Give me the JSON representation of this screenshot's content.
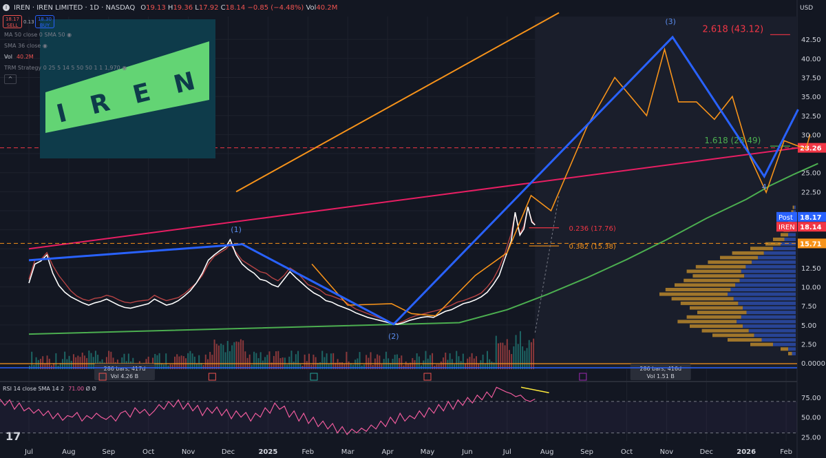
{
  "header": {
    "symbol": "IREN · IREN LIMITED · 1D · NASDAQ",
    "open_label": "O",
    "open": "19.13",
    "high_label": "H",
    "high": "19.36",
    "low_label": "L",
    "low": "17.92",
    "close_label": "C",
    "close": "18.14",
    "change": "−0.85 (−4.48%)",
    "vol_label": "Vol",
    "vol": "40.2M"
  },
  "trade": {
    "sell_price": "18.17",
    "sell_label": "SELL",
    "spread": "0.13",
    "buy_price": "18.30",
    "buy_label": "BUY"
  },
  "indicators": [
    {
      "label": "MA 50 close 0 SMA 50",
      "value": ""
    },
    {
      "label": "SMA 36 close",
      "value": ""
    },
    {
      "label": "Vol",
      "value": "40.2M"
    },
    {
      "label": "TRM Strategy 0 25 5 14 5 50 50 1 1 1,970",
      "value": ""
    }
  ],
  "logo_text": "I R E N",
  "colors": {
    "background": "#131722",
    "up": "#26a69a",
    "down": "#ef5350",
    "wave": "#2962ff",
    "projection": "#f7931a",
    "trend_pink": "#e91e63",
    "curve_green": "#4caf50",
    "rsi": "#ef5b9c",
    "fib_red": "#f23645",
    "fib_green": "#4caf50",
    "fib_orange": "#f7931a",
    "logo_bg": "#0e3b4a",
    "logo_fg": "#63d474"
  },
  "chart_data": {
    "type": "line",
    "title": "IREN · IREN LIMITED · 1D · NASDAQ",
    "currency": "USD",
    "x_labels": [
      "Jul",
      "Aug",
      "Sep",
      "Oct",
      "Nov",
      "Dec",
      "2025",
      "Feb",
      "Mar",
      "Apr",
      "May",
      "Jun",
      "Jul",
      "Aug",
      "Sep",
      "Oct",
      "Nov",
      "Dec",
      "2026",
      "Feb"
    ],
    "x_index": [
      0,
      1,
      2,
      3,
      4,
      5,
      6,
      7,
      8,
      9,
      10,
      11,
      12,
      13,
      14,
      15,
      16,
      17,
      18,
      19
    ],
    "y_ticks": [
      0,
      2.5,
      5,
      7.5,
      10,
      12.5,
      15,
      17.5,
      20,
      22.5,
      25,
      27.5,
      30,
      32.5,
      35,
      37.5,
      40,
      42.5
    ],
    "y_tick_labels": [
      "0.0000",
      "2.50",
      "5.00",
      "7.50",
      "10.00",
      "12.50",
      "15.00",
      "17.50",
      "20.00",
      "22.50",
      "25.00",
      "27.50",
      "30.00",
      "32.50",
      "35.00",
      "37.50",
      "40.00",
      "42.50"
    ],
    "ylim": [
      -0.8,
      45.5
    ],
    "price_close": [
      [
        0.0,
        11.0
      ],
      [
        0.15,
        13.5
      ],
      [
        0.3,
        13.6
      ],
      [
        0.45,
        14.5
      ],
      [
        0.6,
        12.8
      ],
      [
        0.75,
        11.5
      ],
      [
        0.9,
        10.5
      ],
      [
        1.05,
        9.5
      ],
      [
        1.2,
        8.8
      ],
      [
        1.35,
        8.4
      ],
      [
        1.5,
        8.2
      ],
      [
        1.65,
        8.5
      ],
      [
        1.8,
        8.6
      ],
      [
        1.95,
        8.9
      ],
      [
        2.1,
        8.7
      ],
      [
        2.25,
        8.3
      ],
      [
        2.4,
        8.0
      ],
      [
        2.55,
        7.9
      ],
      [
        2.7,
        8.1
      ],
      [
        2.85,
        8.2
      ],
      [
        3.0,
        8.3
      ],
      [
        3.15,
        8.9
      ],
      [
        3.3,
        8.5
      ],
      [
        3.45,
        8.2
      ],
      [
        3.6,
        8.4
      ],
      [
        3.75,
        8.6
      ],
      [
        3.9,
        9.1
      ],
      [
        4.05,
        9.8
      ],
      [
        4.2,
        10.5
      ],
      [
        4.35,
        11.5
      ],
      [
        4.5,
        13.0
      ],
      [
        4.65,
        14.0
      ],
      [
        4.8,
        14.5
      ],
      [
        4.95,
        15.0
      ],
      [
        5.05,
        15.6
      ],
      [
        5.2,
        14.5
      ],
      [
        5.35,
        13.5
      ],
      [
        5.5,
        13.0
      ],
      [
        5.65,
        12.5
      ],
      [
        5.8,
        12.0
      ],
      [
        5.95,
        11.8
      ],
      [
        6.1,
        11.2
      ],
      [
        6.25,
        10.8
      ],
      [
        6.4,
        11.5
      ],
      [
        6.55,
        12.5
      ],
      [
        6.7,
        12.0
      ],
      [
        6.85,
        11.2
      ],
      [
        7.0,
        10.3
      ],
      [
        7.15,
        10.0
      ],
      [
        7.3,
        9.6
      ],
      [
        7.45,
        9.0
      ],
      [
        7.6,
        8.8
      ],
      [
        7.75,
        8.5
      ],
      [
        7.9,
        8.2
      ],
      [
        8.05,
        7.6
      ],
      [
        8.2,
        7.1
      ],
      [
        8.35,
        6.8
      ],
      [
        8.5,
        6.5
      ],
      [
        8.65,
        6.2
      ],
      [
        8.8,
        5.9
      ],
      [
        8.95,
        5.6
      ],
      [
        9.1,
        5.3
      ],
      [
        9.25,
        5.2
      ],
      [
        9.4,
        5.5
      ],
      [
        9.55,
        5.9
      ],
      [
        9.7,
        6.2
      ],
      [
        9.85,
        6.4
      ],
      [
        10.0,
        6.6
      ],
      [
        10.15,
        6.8
      ],
      [
        10.3,
        7.0
      ],
      [
        10.45,
        7.3
      ],
      [
        10.6,
        7.6
      ],
      [
        10.75,
        8.0
      ],
      [
        10.9,
        8.2
      ],
      [
        11.05,
        8.5
      ],
      [
        11.2,
        8.8
      ],
      [
        11.35,
        9.2
      ],
      [
        11.5,
        10.0
      ],
      [
        11.65,
        11.0
      ],
      [
        11.8,
        12.5
      ],
      [
        11.95,
        14.5
      ],
      [
        12.1,
        17.0
      ],
      [
        12.2,
        19.6
      ],
      [
        12.32,
        17.0
      ],
      [
        12.42,
        18.0
      ],
      [
        12.52,
        20.4
      ],
      [
        12.62,
        18.7
      ],
      [
        12.7,
        18.14
      ]
    ],
    "price_line_white": [
      [
        0.0,
        10.5
      ],
      [
        0.15,
        13.0
      ],
      [
        0.3,
        13.4
      ],
      [
        0.45,
        14.2
      ],
      [
        0.6,
        11.8
      ],
      [
        0.75,
        10.2
      ],
      [
        0.9,
        9.3
      ],
      [
        1.05,
        8.7
      ],
      [
        1.2,
        8.3
      ],
      [
        1.35,
        7.9
      ],
      [
        1.5,
        7.6
      ],
      [
        1.65,
        7.9
      ],
      [
        1.8,
        8.1
      ],
      [
        1.95,
        8.4
      ],
      [
        2.1,
        8.0
      ],
      [
        2.25,
        7.6
      ],
      [
        2.4,
        7.3
      ],
      [
        2.55,
        7.2
      ],
      [
        2.7,
        7.4
      ],
      [
        2.85,
        7.6
      ],
      [
        3.0,
        7.8
      ],
      [
        3.15,
        8.4
      ],
      [
        3.3,
        8.0
      ],
      [
        3.45,
        7.6
      ],
      [
        3.6,
        7.8
      ],
      [
        3.75,
        8.2
      ],
      [
        3.9,
        8.8
      ],
      [
        4.05,
        9.5
      ],
      [
        4.2,
        10.5
      ],
      [
        4.35,
        11.8
      ],
      [
        4.5,
        13.5
      ],
      [
        4.65,
        14.2
      ],
      [
        4.8,
        14.8
      ],
      [
        4.95,
        15.3
      ],
      [
        5.05,
        16.2
      ],
      [
        5.2,
        14.2
      ],
      [
        5.35,
        13.0
      ],
      [
        5.5,
        12.3
      ],
      [
        5.65,
        11.8
      ],
      [
        5.8,
        11.0
      ],
      [
        5.95,
        10.8
      ],
      [
        6.1,
        10.3
      ],
      [
        6.25,
        10.0
      ],
      [
        6.4,
        11.0
      ],
      [
        6.55,
        12.0
      ],
      [
        6.7,
        11.2
      ],
      [
        6.85,
        10.5
      ],
      [
        7.0,
        9.8
      ],
      [
        7.15,
        9.2
      ],
      [
        7.3,
        8.8
      ],
      [
        7.45,
        8.2
      ],
      [
        7.6,
        8.0
      ],
      [
        7.75,
        7.6
      ],
      [
        7.9,
        7.3
      ],
      [
        8.05,
        7.0
      ],
      [
        8.2,
        6.6
      ],
      [
        8.35,
        6.3
      ],
      [
        8.5,
        6.0
      ],
      [
        8.65,
        5.8
      ],
      [
        8.8,
        5.6
      ],
      [
        8.95,
        5.4
      ],
      [
        9.1,
        5.2
      ],
      [
        9.25,
        5.1
      ],
      [
        9.4,
        5.3
      ],
      [
        9.55,
        5.6
      ],
      [
        9.7,
        5.8
      ],
      [
        9.85,
        6.0
      ],
      [
        10.0,
        6.1
      ],
      [
        10.15,
        6.0
      ],
      [
        10.3,
        6.4
      ],
      [
        10.45,
        6.8
      ],
      [
        10.6,
        7.0
      ],
      [
        10.75,
        7.4
      ],
      [
        10.9,
        7.8
      ],
      [
        11.05,
        8.0
      ],
      [
        11.2,
        8.3
      ],
      [
        11.35,
        8.7
      ],
      [
        11.5,
        9.3
      ],
      [
        11.65,
        10.3
      ],
      [
        11.8,
        11.5
      ],
      [
        11.95,
        13.8
      ],
      [
        12.1,
        16.0
      ],
      [
        12.2,
        19.8
      ],
      [
        12.32,
        16.8
      ],
      [
        12.42,
        17.6
      ],
      [
        12.52,
        20.5
      ],
      [
        12.62,
        18.5
      ],
      [
        12.7,
        18.14
      ]
    ],
    "elliott_wave": [
      [
        0.0,
        13.5
      ],
      [
        5.35,
        15.6
      ],
      [
        9.15,
        5.1
      ],
      [
        16.15,
        42.8
      ],
      [
        18.45,
        24.5
      ],
      [
        19.3,
        33.3
      ]
    ],
    "wave_labels": [
      {
        "text": "(1)",
        "x": 5.2,
        "y": 17.2
      },
      {
        "text": "(2)",
        "x": 9.15,
        "y": 3.2
      },
      {
        "text": "(3)",
        "x": 16.1,
        "y": 44.5
      },
      {
        "text": "4",
        "x": 18.45,
        "y": 22.8
      }
    ],
    "projection_orange": [
      [
        7.1,
        13.0
      ],
      [
        8.0,
        7.6
      ],
      [
        9.1,
        7.8
      ],
      [
        9.6,
        6.5
      ],
      [
        10.2,
        6.2
      ],
      [
        11.2,
        11.5
      ],
      [
        12.0,
        14.5
      ],
      [
        12.6,
        22.0
      ],
      [
        13.1,
        20.0
      ],
      [
        14.0,
        31.0
      ],
      [
        14.7,
        37.5
      ],
      [
        15.5,
        32.5
      ],
      [
        15.95,
        41.2
      ],
      [
        16.3,
        34.3
      ],
      [
        16.75,
        34.3
      ],
      [
        17.2,
        32.0
      ],
      [
        17.65,
        35.0
      ],
      [
        18.1,
        27.0
      ],
      [
        18.5,
        22.4
      ],
      [
        18.95,
        29.2
      ],
      [
        19.5,
        28.1
      ],
      [
        19.6,
        30.0
      ]
    ],
    "trend_orange": [
      [
        5.2,
        22.5
      ],
      [
        13.3,
        46.0
      ]
    ],
    "trend_pink": [
      [
        0.0,
        15.0
      ],
      [
        19.8,
        28.6
      ]
    ],
    "curve_green": [
      [
        0.0,
        3.8
      ],
      [
        10.8,
        5.3
      ],
      [
        12.0,
        7.0
      ],
      [
        13.0,
        9.0
      ],
      [
        14.0,
        11.2
      ],
      [
        15.0,
        13.6
      ],
      [
        16.0,
        16.2
      ],
      [
        17.0,
        19.0
      ],
      [
        18.0,
        21.5
      ],
      [
        18.6,
        23.3
      ],
      [
        19.2,
        24.8
      ],
      [
        19.8,
        26.2
      ]
    ],
    "fib_levels": [
      {
        "label": "0.236 (17.76)",
        "value": 17.76,
        "color": "#f23645"
      },
      {
        "label": "0.382 (15.38)",
        "value": 15.38,
        "color": "#f7931a"
      },
      {
        "label": "1.618 (28.49)",
        "value": 28.49,
        "color": "#4caf50"
      },
      {
        "label": "2.618 (43.12)",
        "value": 43.12,
        "color": "#f23645"
      }
    ],
    "hlines": [
      {
        "value": 28.26,
        "label": "28.26",
        "color": "#f23645",
        "style": "dashed"
      },
      {
        "value": 15.71,
        "label": "15.71",
        "color": "#f7931a",
        "style": "dashed"
      }
    ],
    "price_badges": [
      {
        "tag": "Post",
        "value": "18.17",
        "color": "#2962ff"
      },
      {
        "tag": "IREN",
        "value": "18.14",
        "color": "#f23645"
      }
    ],
    "range_notes": [
      {
        "line1": "286 bars, 417d",
        "line2": "Vol 4.26 B"
      },
      {
        "line1": "286 bars, 416d",
        "line2": "Vol 1.51 B"
      }
    ],
    "rsi": {
      "label": "RSI 14 close SMA 14 2",
      "value": "71.00",
      "extra": "Ø Ø",
      "y_ticks": [
        25,
        50,
        75
      ],
      "y_tick_labels": [
        "25.00",
        "50.00",
        "75.00"
      ],
      "ylim": [
        20,
        90
      ],
      "values": [
        73,
        65,
        72,
        60,
        68,
        58,
        62,
        55,
        60,
        52,
        58,
        48,
        55,
        46,
        52,
        50,
        56,
        45,
        52,
        48,
        55,
        50,
        47,
        52,
        45,
        55,
        58,
        50,
        62,
        55,
        60,
        52,
        58,
        66,
        60,
        70,
        63,
        72,
        60,
        68,
        58,
        65,
        52,
        62,
        55,
        63,
        52,
        60,
        48,
        58,
        50,
        56,
        45,
        55,
        50,
        62,
        55,
        68,
        60,
        64,
        50,
        58,
        45,
        55,
        42,
        50,
        38,
        45,
        35,
        42,
        30,
        38,
        28,
        35,
        30,
        36,
        32,
        40,
        35,
        45,
        38,
        50,
        42,
        55,
        45,
        52,
        48,
        58,
        50,
        62,
        55,
        66,
        58,
        70,
        60,
        72,
        65,
        75,
        68,
        78,
        72,
        82,
        75,
        88,
        85,
        82,
        80,
        76,
        78,
        72,
        70,
        73
      ]
    },
    "volume_profile": [
      [
        1.2,
        0.05
      ],
      [
        1.8,
        0.1
      ],
      [
        2.4,
        0.3
      ],
      [
        3.0,
        0.45
      ],
      [
        3.6,
        0.55
      ],
      [
        4.2,
        0.62
      ],
      [
        4.8,
        0.7
      ],
      [
        5.4,
        0.78
      ],
      [
        6.0,
        0.72
      ],
      [
        6.6,
        0.65
      ],
      [
        7.2,
        0.7
      ],
      [
        7.8,
        0.76
      ],
      [
        8.4,
        0.82
      ],
      [
        9.0,
        0.9
      ],
      [
        9.6,
        0.86
      ],
      [
        10.2,
        0.8
      ],
      [
        10.8,
        0.74
      ],
      [
        11.4,
        0.68
      ],
      [
        12.0,
        0.72
      ],
      [
        12.6,
        0.66
      ],
      [
        13.2,
        0.58
      ],
      [
        13.8,
        0.5
      ],
      [
        14.4,
        0.42
      ],
      [
        15.0,
        0.3
      ],
      [
        15.6,
        0.2
      ],
      [
        16.2,
        0.15
      ],
      [
        16.8,
        0.1
      ],
      [
        17.4,
        0.08
      ],
      [
        18.0,
        0.06
      ],
      [
        18.6,
        0.05
      ],
      [
        19.2,
        0.04
      ],
      [
        19.8,
        0.03
      ],
      [
        20.4,
        0.02
      ]
    ],
    "volume_bars_note": "volume histogram along bottom of price pane",
    "grid": true,
    "legend_position": "top-left"
  }
}
